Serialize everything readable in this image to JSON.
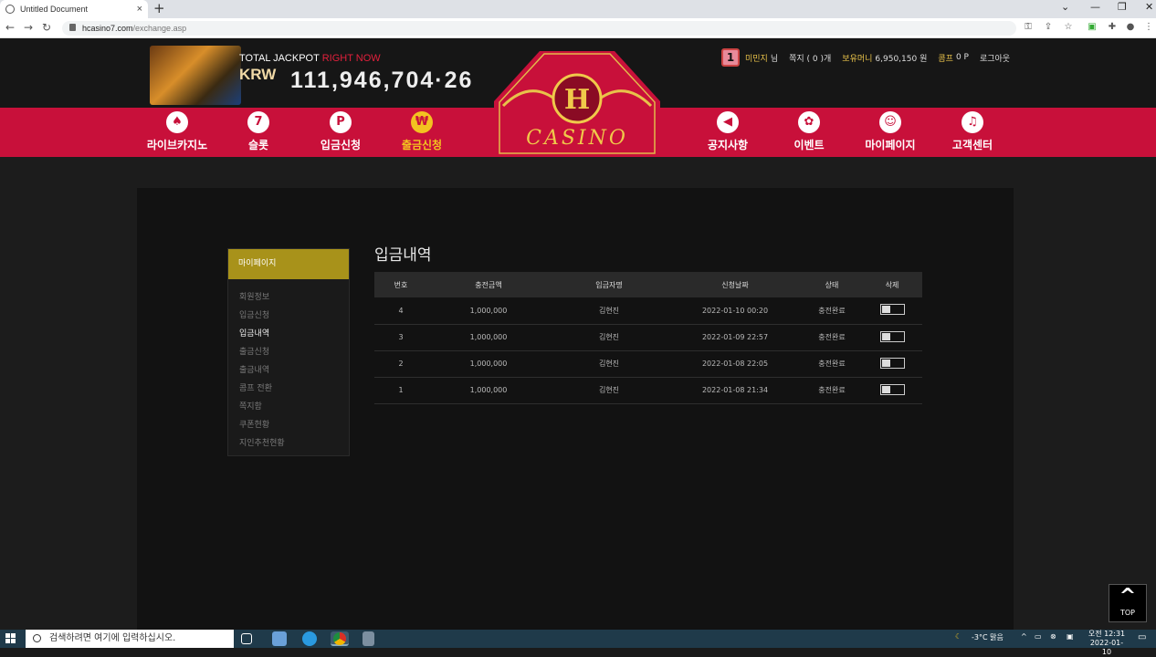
{
  "browser": {
    "tab_title": "Untitled Document",
    "close": "×",
    "new_tab": "+",
    "url_host": "hcasino7.com",
    "url_path": "/exchange.asp",
    "back": "←",
    "forward": "→",
    "reload": "↻",
    "minimize": "—",
    "maximize": "❐",
    "close_window": "✕",
    "chevron": "⌄"
  },
  "jackpot": {
    "label": "TOTAL JACKPOT",
    "label_accent": "RIGHT NOW",
    "currency": "KRW",
    "amount": "111,946,704·26"
  },
  "user": {
    "level": "1",
    "name": "미민지",
    "honorific": "님",
    "memo": "쪽지 ( 0 )개",
    "money_label": "보유머니",
    "money_value": "6,950,150 원",
    "comp_label": "콤프",
    "comp_value": "0 P",
    "logout": "로그아웃"
  },
  "nav": {
    "live_casino": "라이브카지노",
    "slot": "슬롯",
    "deposit": "입금신청",
    "withdraw": "출금신청",
    "notice": "공지사항",
    "event": "이벤트",
    "mypage": "마이페이지",
    "support": "고객센터"
  },
  "logo": {
    "letter": "H",
    "text": "CASINO"
  },
  "sidebar": {
    "title": "마이페이지",
    "items": [
      "회원정보",
      "입금신청",
      "입금내역",
      "출금신청",
      "출금내역",
      "콤프 전환",
      "쪽지함",
      "쿠폰현황",
      "지인추천현황"
    ]
  },
  "main": {
    "title": "입금내역",
    "columns": [
      "번호",
      "충전금액",
      "입금자명",
      "신청날짜",
      "상태",
      "삭제"
    ],
    "rows": [
      {
        "no": "4",
        "amount": "1,000,000",
        "depositor": "김현진",
        "date": "2022-01-10 00:20",
        "status": "충전완료"
      },
      {
        "no": "3",
        "amount": "1,000,000",
        "depositor": "김현진",
        "date": "2022-01-09 22:57",
        "status": "충전완료"
      },
      {
        "no": "2",
        "amount": "1,000,000",
        "depositor": "김현진",
        "date": "2022-01-08 22:05",
        "status": "충전완료"
      },
      {
        "no": "1",
        "amount": "1,000,000",
        "depositor": "김현진",
        "date": "2022-01-08 21:34",
        "status": "충전완료"
      }
    ]
  },
  "top_button": "TOP",
  "taskbar": {
    "search_placeholder": "검색하려면 여기에 입력하십시오.",
    "weather": "-3°C 맑음",
    "time": "오전 12:31",
    "date": "2022-01-10"
  }
}
